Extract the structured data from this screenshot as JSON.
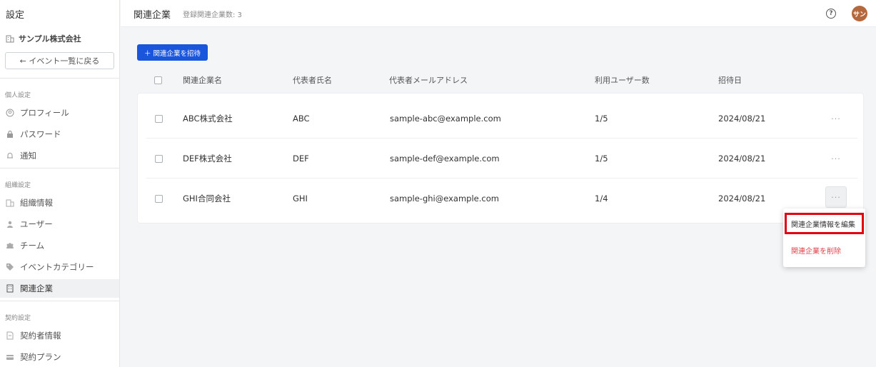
{
  "sidebar": {
    "title": "設定",
    "org_name": "サンプル株式会社",
    "back_label": "← イベント一覧に戻る",
    "sections": {
      "personal": "個人設定",
      "organization": "組織設定",
      "contract": "契約設定"
    },
    "items": [
      {
        "label": "プロフィール",
        "icon": "user-circle-icon"
      },
      {
        "label": "パスワード",
        "icon": "lock-icon"
      },
      {
        "label": "通知",
        "icon": "bell-icon"
      },
      {
        "label": "組織情報",
        "icon": "building-icon"
      },
      {
        "label": "ユーザー",
        "icon": "user-icon"
      },
      {
        "label": "チーム",
        "icon": "team-icon"
      },
      {
        "label": "イベントカテゴリー",
        "icon": "tag-icon"
      },
      {
        "label": "関連企業",
        "icon": "building-icon"
      },
      {
        "label": "契約者情報",
        "icon": "document-icon"
      },
      {
        "label": "契約プラン",
        "icon": "card-icon"
      }
    ]
  },
  "header": {
    "title": "関連企業",
    "count_label": "登録関連企業数: 3",
    "avatar_text": "サン"
  },
  "main": {
    "invite_button": "＋ 関連企業を招待",
    "table": {
      "columns": [
        "関連企業名",
        "代表者氏名",
        "代表者メールアドレス",
        "利用ユーザー数",
        "招待日"
      ],
      "rows": [
        {
          "company": "ABC株式会社",
          "rep": "ABC",
          "email": "sample-abc@example.com",
          "users": "1/5",
          "date": "2024/08/21"
        },
        {
          "company": "DEF株式会社",
          "rep": "DEF",
          "email": "sample-def@example.com",
          "users": "1/5",
          "date": "2024/08/21"
        },
        {
          "company": "GHI合同会社",
          "rep": "GHI",
          "email": "sample-ghi@example.com",
          "users": "1/4",
          "date": "2024/08/21"
        }
      ],
      "more_label": "···"
    },
    "menu": {
      "edit": "関連企業情報を編集",
      "delete": "関連企業を削除"
    }
  },
  "colors": {
    "accent": "#1a56db",
    "danger": "#e0424b",
    "highlight": "#e00010",
    "avatar": "#b4683c"
  }
}
